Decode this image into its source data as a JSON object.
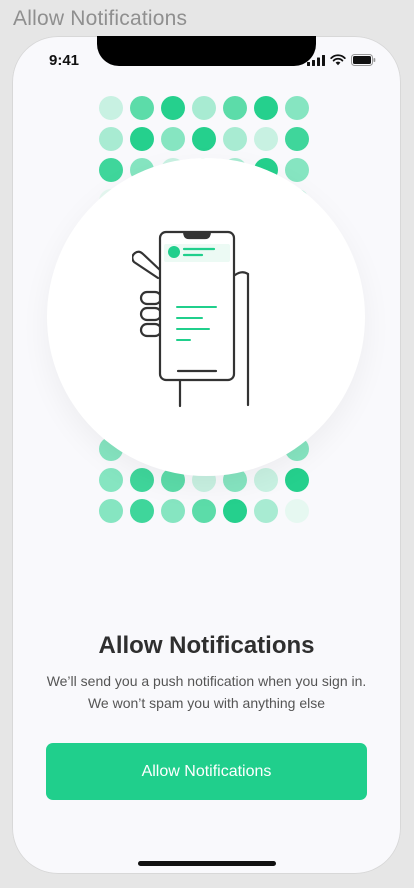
{
  "frame": {
    "title": "Allow Notifications"
  },
  "status_bar": {
    "time": "9:41",
    "icons": [
      "cellular-signal-icon",
      "wifi-icon",
      "battery-icon"
    ]
  },
  "illustration": {
    "name": "hand-holding-phone-illustration"
  },
  "content": {
    "heading": "Allow Notifications",
    "subtitle": "We’ll send you a push notification when you sign in. We won’t spam you with anything else"
  },
  "cta": {
    "label": "Allow Notifications"
  },
  "colors": {
    "accent": "#20cf8c",
    "dots": [
      "#e6f8f1",
      "#c8f1e2",
      "#a8ebd2",
      "#86e5c1",
      "#5cdca9",
      "#3fd69b",
      "#25d08d"
    ]
  }
}
